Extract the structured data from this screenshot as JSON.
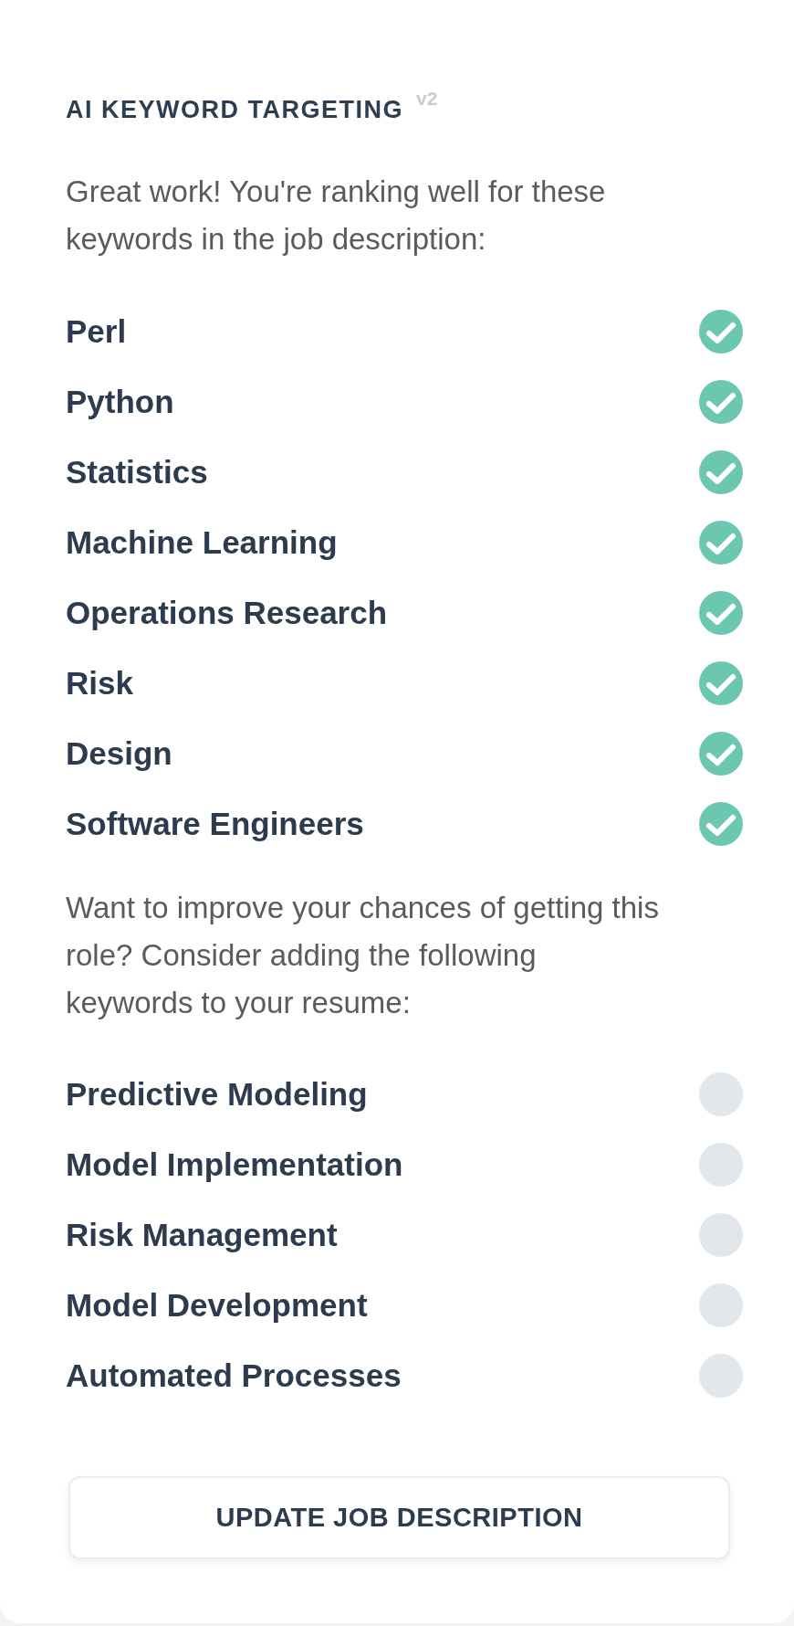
{
  "section": {
    "title": "AI KEYWORD TARGETING",
    "version": "v2"
  },
  "matched_intro": "Great work! You're ranking well for these keywords in the job description:",
  "matched_keywords": [
    {
      "label": "Perl",
      "checked": true
    },
    {
      "label": "Python",
      "checked": true
    },
    {
      "label": "Statistics",
      "checked": true
    },
    {
      "label": "Machine Learning",
      "checked": true
    },
    {
      "label": "Operations Research",
      "checked": true
    },
    {
      "label": "Risk",
      "checked": true
    },
    {
      "label": "Design",
      "checked": true
    },
    {
      "label": "Software Engineers",
      "checked": true
    }
  ],
  "suggestion_intro": "Want to improve your chances of getting this role? Consider adding the following keywords to your resume:",
  "suggested_keywords": [
    {
      "label": "Predictive Modeling",
      "checked": false
    },
    {
      "label": "Model Implementation",
      "checked": false
    },
    {
      "label": "Risk Management",
      "checked": false
    },
    {
      "label": "Model Development",
      "checked": false
    },
    {
      "label": "Automated Processes",
      "checked": false
    }
  ],
  "button": {
    "label": "UPDATE JOB DESCRIPTION"
  }
}
